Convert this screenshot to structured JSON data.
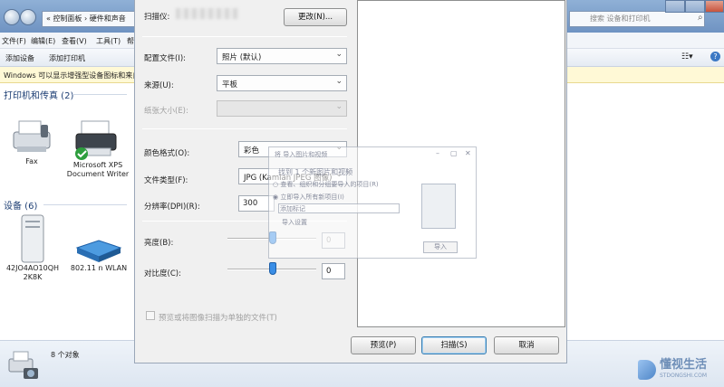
{
  "explorer": {
    "address_text": "« 控制面板 › 硬件和声音",
    "search_placeholder": "搜索 设备和打印机",
    "menu": [
      "文件(F)",
      "编辑(E)",
      "查看(V)",
      "工具(T)",
      "帮"
    ],
    "commands": [
      "添加设备",
      "添加打印机"
    ],
    "info_bar": "Windows 可以显示增强型设备图标和来自",
    "groups": [
      {
        "title": "打印机和传真 (2)"
      },
      {
        "title": "设备 (6)"
      }
    ],
    "printers": [
      {
        "name": "Fax",
        "icon": "fax-icon"
      },
      {
        "name": "Microsoft XPS Document Writer",
        "icon": "printer-icon"
      }
    ],
    "devices": [
      {
        "name": "42JO4AO10QH 2K8K",
        "icon": "computer-icon"
      },
      {
        "name": "802.11 n WLAN",
        "icon": "network-adapter-icon"
      }
    ],
    "status_count": "8 个对象"
  },
  "scan_dialog": {
    "scanner_label": "扫描仪:",
    "change_button": "更改(N)...",
    "profile_label": "配置文件(I):",
    "profile_value": "照片 (默认)",
    "source_label": "来源(U):",
    "source_value": "平板",
    "paper_size_label": "纸张大小(E):",
    "color_format_label": "颜色格式(O):",
    "color_format_value": "彩色",
    "file_type_label": "文件类型(F):",
    "file_type_value": "JPG (Kamlan JPEG 图像)",
    "resolution_label": "分辨率(DPI)(R):",
    "resolution_value": "300",
    "brightness_label": "亮度(B):",
    "brightness_value": "0",
    "contrast_label": "对比度(C):",
    "contrast_value": "0",
    "preview_checkbox_label": "预览或将图像扫描为单独的文件(T)",
    "preview_button": "预览(P)",
    "scan_button": "扫描(S)",
    "cancel_button": "取消"
  },
  "ghost_dialog": {
    "title": "将 导入图片和视频",
    "line1": "找到 1 个新图片和视频",
    "line2": "○ 查看、组织和分组要导入的项目(R)",
    "line3": "◉ 立即导入所有新项目(I)",
    "line4": "添加标记",
    "line5": "导入设置",
    "button": "导入"
  },
  "watermark": {
    "brand": "懂视生活",
    "domain": "STDONGSHI.COM"
  },
  "colors": {
    "accent": "#3a8ee6",
    "title_bar": "#7f9fca",
    "info_bar": "#fff9d6"
  }
}
